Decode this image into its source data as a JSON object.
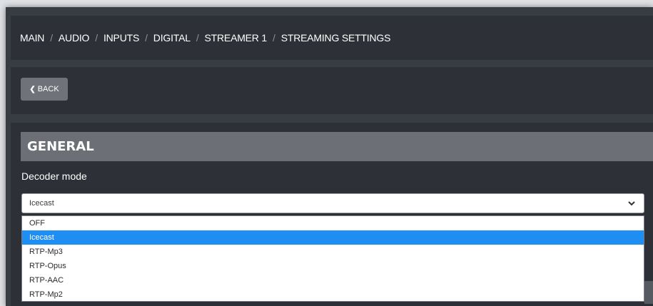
{
  "breadcrumb": {
    "items": [
      "MAIN",
      "AUDIO",
      "INPUTS",
      "DIGITAL",
      "STREAMER 1",
      "STREAMING SETTINGS"
    ],
    "separator": "/"
  },
  "back_button": {
    "label": "BACK",
    "icon": "chevron-left-icon"
  },
  "general": {
    "title": "GENERAL",
    "decoder_mode": {
      "label": "Decoder mode",
      "selected": "Icecast",
      "options": [
        "OFF",
        "Icecast",
        "RTP-Mp3",
        "RTP-Opus",
        "RTP-AAC",
        "RTP-Mp2"
      ],
      "highlighted_index": 1
    }
  },
  "colors": {
    "accent": "#1f8ef2",
    "panel": "#2d3137",
    "header": "#6c7076"
  }
}
